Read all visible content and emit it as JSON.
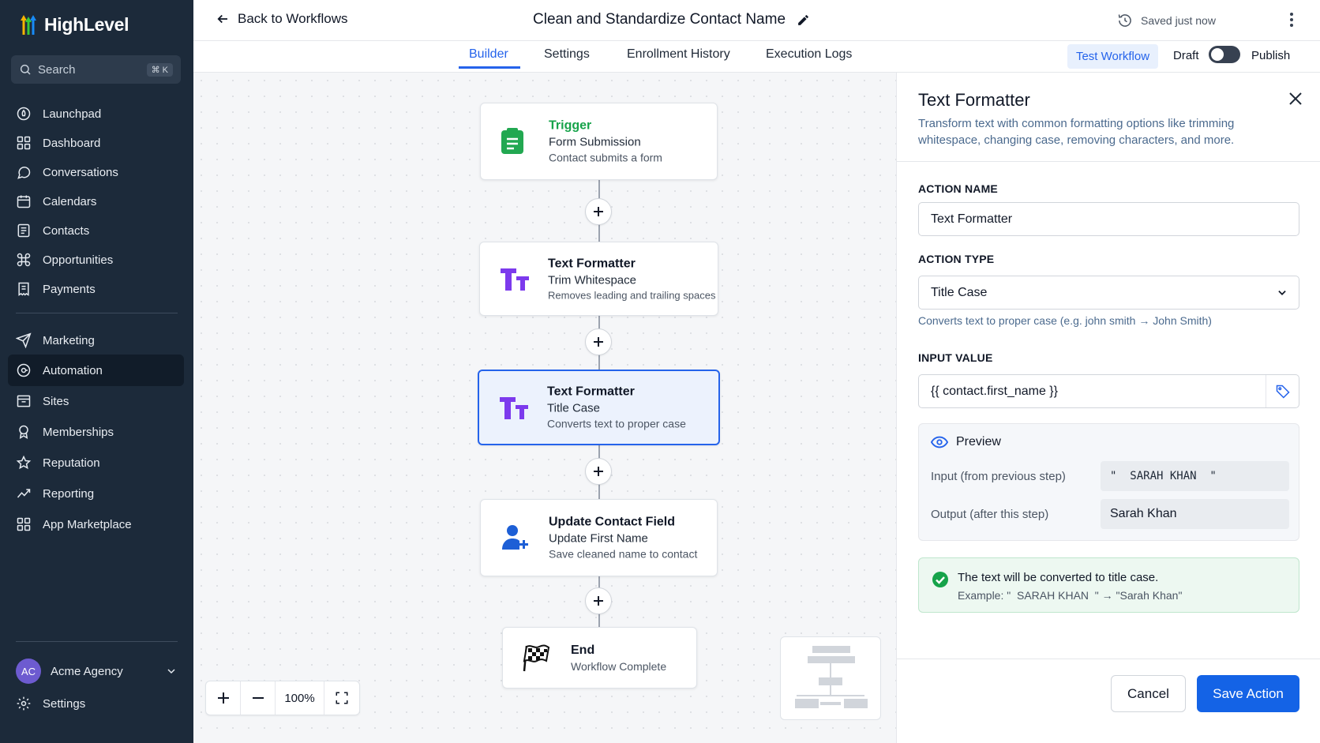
{
  "app": {
    "name": "HighLevel"
  },
  "search": {
    "placeholder": "Search",
    "shortcut": "⌘ K"
  },
  "sidebar": {
    "items": [
      {
        "label": "Launchpad",
        "icon": "launchpad-icon"
      },
      {
        "label": "Dashboard",
        "icon": "dashboard-icon"
      },
      {
        "label": "Conversations",
        "icon": "chat-icon"
      },
      {
        "label": "Calendars",
        "icon": "calendar-icon"
      },
      {
        "label": "Contacts",
        "icon": "contacts-icon"
      },
      {
        "label": "Opportunities",
        "icon": "opportunities-icon"
      },
      {
        "label": "Payments",
        "icon": "receipt-icon"
      },
      {
        "label": "Marketing",
        "icon": "send-icon"
      },
      {
        "label": "Automation",
        "icon": "automation-icon"
      },
      {
        "label": "Sites",
        "icon": "sites-icon"
      },
      {
        "label": "Memberships",
        "icon": "membership-icon"
      },
      {
        "label": "Reputation",
        "icon": "star-icon"
      },
      {
        "label": "Reporting",
        "icon": "chart-line-icon"
      },
      {
        "label": "App Marketplace",
        "icon": "apps-grid-icon"
      }
    ],
    "active": "Automation",
    "account": {
      "initials": "AC",
      "name": "Acme Agency"
    },
    "settings_label": "Settings"
  },
  "header": {
    "back_label": "Back to Workflows",
    "workflow_title": "Clean and Standardize Contact Name",
    "saved_status": "Saved just now"
  },
  "tabs": [
    {
      "label": "Builder",
      "active": true
    },
    {
      "label": "Settings",
      "active": false
    },
    {
      "label": "Enrollment History",
      "active": false
    },
    {
      "label": "Execution Logs",
      "active": false
    }
  ],
  "actions": {
    "test_label": "Test Workflow",
    "draft_label": "Draft",
    "publish_label": "Publish",
    "publish_toggle_on": false
  },
  "workflow": {
    "nodes": [
      {
        "label": "Trigger",
        "title": "Form Submission",
        "desc": "Contact submits a form",
        "icon": "form-icon"
      },
      {
        "label": "Text Formatter",
        "title": "Trim Whitespace",
        "desc": "Removes leading and trailing spaces",
        "icon": "text-format-icon"
      },
      {
        "label": "Text Formatter",
        "title": "Title Case",
        "desc": "Converts text to proper case",
        "icon": "text-format-icon",
        "selected": true
      },
      {
        "label": "Update Contact Field",
        "title": "Update First Name",
        "desc": "Save cleaned name to contact",
        "icon": "user-add-icon"
      },
      {
        "label": "End",
        "title": "Workflow Complete",
        "icon": "finish-flag-icon"
      }
    ],
    "zoom": "100%"
  },
  "panel": {
    "title": "Text Formatter",
    "description": "Transform text with common formatting options like trimming whitespace, changing case, removing characters, and more.",
    "action_name_label": "ACTION NAME",
    "action_name_value": "Text Formatter",
    "action_type_label": "ACTION TYPE",
    "action_type_value": "Title Case",
    "action_type_help": "Converts text to proper case (e.g. john smith → John Smith)",
    "input_value_label": "INPUT VALUE",
    "input_value": "{{ contact.first_name }}",
    "preview": {
      "title": "Preview",
      "input_label": "Input (from previous step)",
      "input_value": "\"  SARAH KHAN  \"",
      "output_label": "Output (after this step)",
      "output_value": "Sarah Khan"
    },
    "alert": {
      "line1": "The text will be converted to title case.",
      "line2": "Example: \"  SARAH KHAN  \" → \"Sarah Khan\""
    },
    "cancel_label": "Cancel",
    "save_label": "Save Action"
  },
  "colors": {
    "sidebar_bg": "#1c2a3a",
    "accent": "#2563eb",
    "success": "#16a34a",
    "brand_purple": "#7c3aed"
  }
}
